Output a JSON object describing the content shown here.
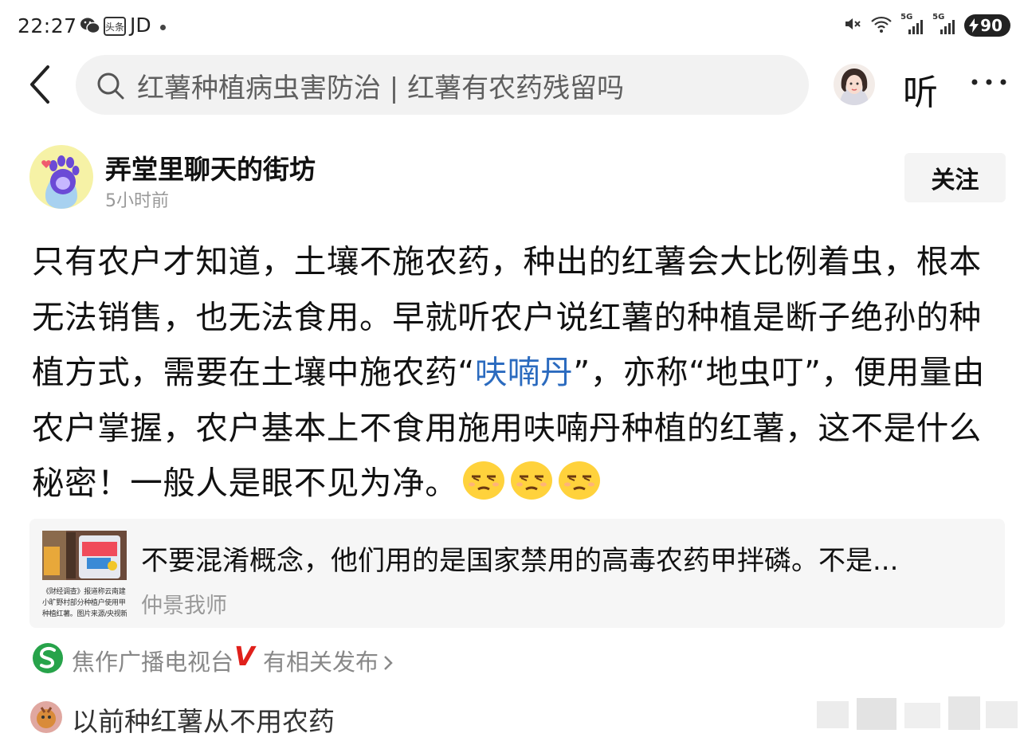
{
  "status_bar": {
    "time": "22:27",
    "app_badge": "头条",
    "carrier_text": "JD",
    "network_1": "5G",
    "network_2": "5G",
    "battery": "90"
  },
  "nav": {
    "search_text": "红薯种植病虫害防治 | 红薯有农药残留吗",
    "listen_label": "听"
  },
  "post": {
    "author_name": "弄堂里聊天的街坊",
    "time": "5小时前",
    "follow_label": "关注",
    "text_part1": "只有农户才知道，土壤不施农药，种出的红薯会大比例着虫，根本无法销售，也无法食用。早就听农户说红薯的种植是断子绝孙的种植方式，需要在土壤中施农药“",
    "text_link": "呋喃丹",
    "text_part2": "”，亦称“地虫叮”，便用量由农户掌握，农户基本上不食用施用呋喃丹种植的红薯，这不是什么秘密！一般人是眼不见为净。"
  },
  "quote": {
    "thumb_caption_1": "《财经调查》报道称云南建",
    "thumb_caption_2": "小旷野村部分种植户使用甲",
    "thumb_caption_3": "种植红薯。图片来源/央视新",
    "text": "不要混淆概念，他们用的是国家禁用的高毒农药甲拌磷。不是...",
    "author": "仲景我师"
  },
  "related": {
    "source": "焦作广播电视台",
    "verified_mark": "V",
    "link": "有相关发布"
  },
  "comment": {
    "text": "以前种红薯从不用农药"
  },
  "colors": {
    "link": "#2b6bbf",
    "verified": "#e0201b",
    "search_bg": "#f2f2f2",
    "card_bg": "#f6f6f6"
  }
}
